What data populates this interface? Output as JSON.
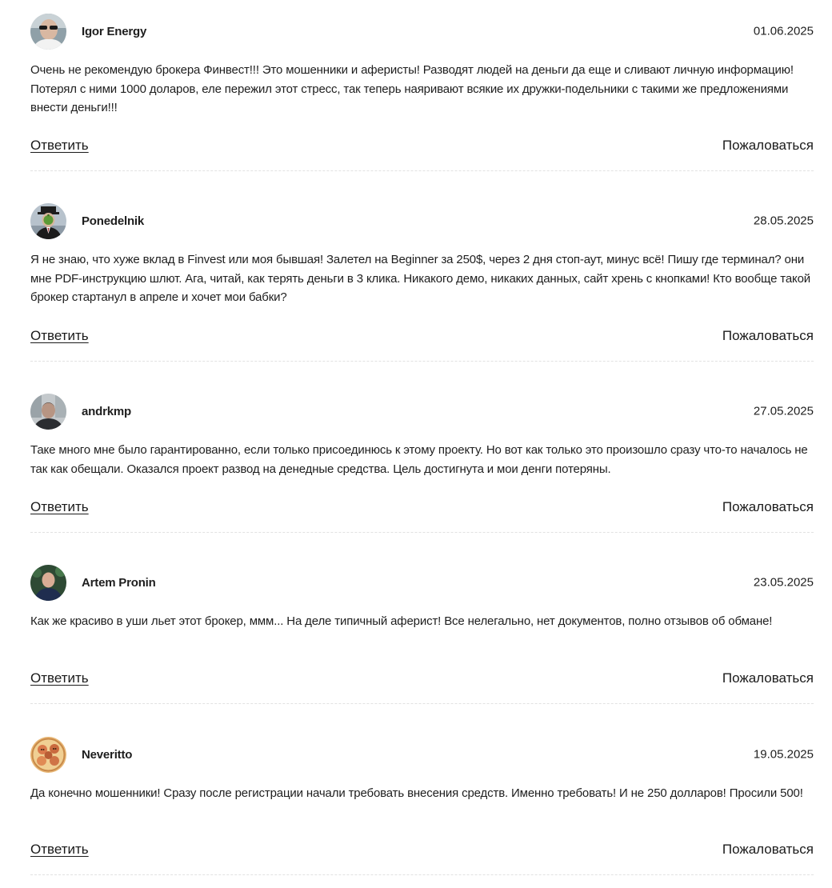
{
  "comments": [
    {
      "author": "Igor Energy",
      "date": "01.06.2025",
      "text": "Очень не рекомендую брокера Финвест!!! Это мошенники и аферисты! Разводят людей на деньги да еще и сливают личную информацию! Потерял с ними 1000 доларов, еле пережил этот стресс, так теперь наяривают всякие их дружки-подельники с такими же предложениями внести деньги!!!",
      "reply_label": "Ответить",
      "report_label": "Пожаловаться",
      "avatar": "user-photo-sunglasses"
    },
    {
      "author": "Ponedelnik",
      "date": "28.05.2025",
      "text": "Я не знаю, что хуже вклад в Finvest или моя бывшая! Залетел на Beginner за 250$, через 2 дня стоп-аут, минус всё! Пишу где терминал? они мне PDF-инструкцию шлют. Ага, читай, как терять деньги в 3 клика. Никакого демо, никаких данных, сайт хрень с кнопками! Кто вообще такой брокер стартанул в апреле и хочет мои бабки?",
      "reply_label": "Ответить",
      "report_label": "Пожаловаться",
      "avatar": "bowler-hat-apple-painting"
    },
    {
      "author": "andrkmp",
      "date": "27.05.2025",
      "text": "Таке много мне было гарантированно, если только присоединюсь к этому проекту. Но вот как только это произошло сразу что-то началось не так как обещали. Оказался проект развод на денедные средства. Цель достигнута и мои денги потеряны.",
      "reply_label": "Ответить",
      "report_label": "Пожаловаться",
      "avatar": "user-photo-city"
    },
    {
      "author": "Artem Pronin",
      "date": "23.05.2025",
      "text": "Как же красиво в уши льет этот брокер, ммм... На деле типичный аферист! Все нелегально, нет документов, полно отзывов об обмане!",
      "reply_label": "Ответить",
      "report_label": "Пожаловаться",
      "avatar": "user-photo-dark-shirt"
    },
    {
      "author": "Neveritto",
      "date": "19.05.2025",
      "text": "Да конечно мошенники! Сразу после регистрации начали требовать внесения средств. Именно требовать! И не 250 долларов! Просили 500!",
      "reply_label": "Ответить",
      "report_label": "Пожаловаться",
      "avatar": "illustrated-faces-circle"
    }
  ]
}
